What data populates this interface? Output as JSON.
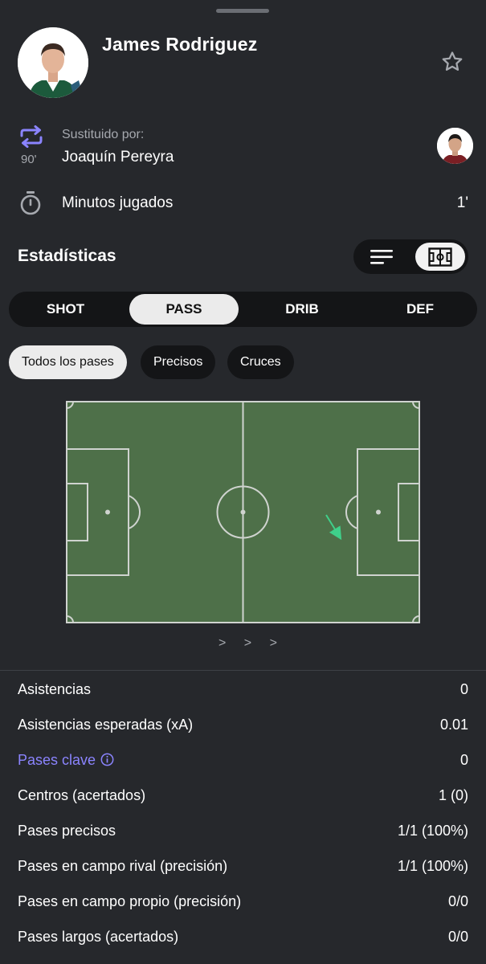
{
  "player": {
    "name": "James Rodriguez"
  },
  "substitution": {
    "label": "Sustituido por:",
    "player": "Joaquín Pereyra",
    "minute": "90'"
  },
  "minutes": {
    "label": "Minutos jugados",
    "value": "1'"
  },
  "stats_title": "Estadísticas",
  "view_toggle": {
    "options": [
      "list-icon",
      "pitch-icon"
    ],
    "selected": "pitch-icon"
  },
  "tabs": [
    "SHOT",
    "PASS",
    "DRIB",
    "DEF"
  ],
  "active_tab": "PASS",
  "filters": [
    "Todos los pases",
    "Precisos",
    "Cruces"
  ],
  "active_filter": "Todos los pases",
  "pass_map": {
    "passes": [
      {
        "accurate": true,
        "color": "#3fd08a"
      }
    ]
  },
  "pager": "> > >",
  "stats": [
    {
      "label": "Asistencias",
      "value": "0"
    },
    {
      "label": "Asistencias esperadas (xA)",
      "value": "0.01"
    },
    {
      "label": "Pases clave",
      "value": "0"
    },
    {
      "label": "Centros (acertados)",
      "value": "1 (0)"
    },
    {
      "label": "Pases precisos",
      "value": "1/1 (100%)"
    },
    {
      "label": "Pases en campo rival (precisión)",
      "value": "1/1 (100%)"
    },
    {
      "label": "Pases en campo propio (precisión)",
      "value": "0/0"
    },
    {
      "label": "Pases largos (acertados)",
      "value": "0/0"
    }
  ],
  "colors": {
    "background": "#26282c",
    "pitch": "#4e7049",
    "accent": "#8b84ff",
    "pass_arrow": "#3fd08a"
  }
}
